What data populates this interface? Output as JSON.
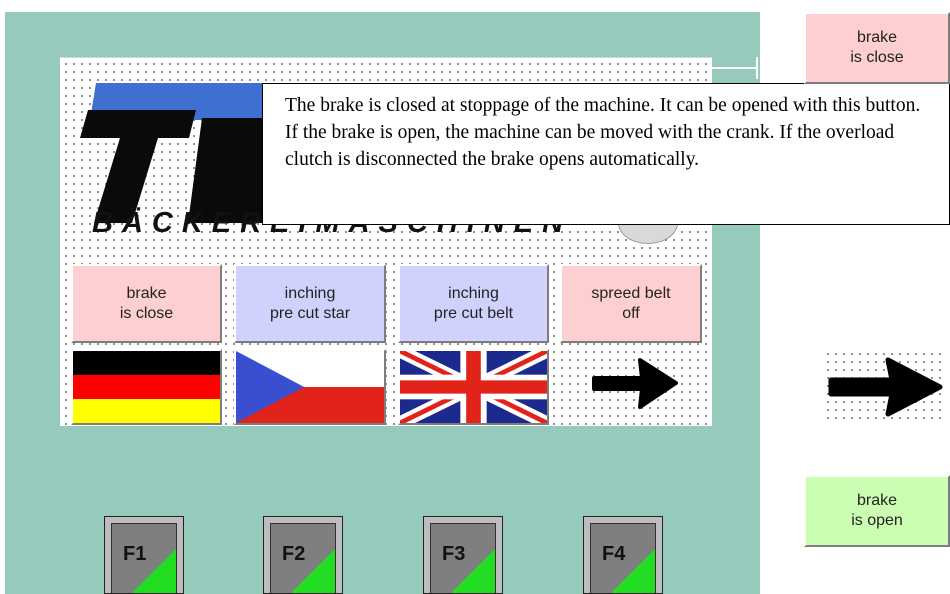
{
  "tooltip": {
    "text": "The brake is closed at stoppage of the machine. It can be opened with this button. If the brake is open, the machine can be moved with the crank. If the overload clutch  is disconnected the brake opens automatically."
  },
  "logo": {
    "tagline": "BÄCKEREIMASCHINEN"
  },
  "screen_buttons": [
    {
      "label": "brake\nis close",
      "color": "#fdcfd0"
    },
    {
      "label": "inching\npre cut star",
      "color": "#d0d2fd"
    },
    {
      "label": "inching\npre cut belt",
      "color": "#d0d2fd"
    },
    {
      "label": "spreed belt\noff",
      "color": "#fdcfd0"
    }
  ],
  "language_flags": [
    {
      "icon": "germany-flag-icon"
    },
    {
      "icon": "czech-flag-icon"
    },
    {
      "icon": "uk-flag-icon"
    }
  ],
  "right_panel": {
    "brake_close_label": "brake\nis close",
    "brake_open_label": "brake\nis open",
    "arrow_icon": "arrow-right-icon"
  },
  "function_keys": [
    "F1",
    "F2",
    "F3",
    "F4"
  ],
  "colors": {
    "panel": "#95cabd",
    "pink_button": "#fdcfd0",
    "lavender_button": "#d0d2fd",
    "green_button": "#cbfdb2",
    "fkey_accent": "#22dd22"
  }
}
